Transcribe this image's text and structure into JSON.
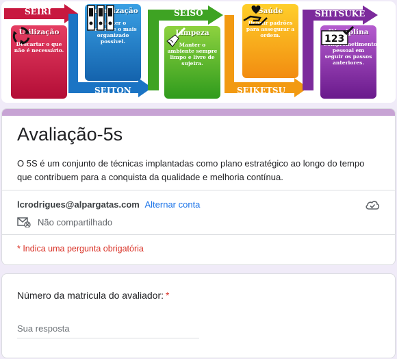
{
  "banner": {
    "steps": [
      {
        "jp": "SEIRI",
        "title": "Utilização",
        "desc": "Descartar o que não é necessário.",
        "icon": "recycle-icon",
        "color": "#c8183f"
      },
      {
        "jp": "SEITON",
        "title": "Organização",
        "desc": "Manter o ambiente o mais organizado possível.",
        "icon": "binders-icon",
        "color": "#1b74c4"
      },
      {
        "jp": "SEISO",
        "title": "Limpeza",
        "desc": "Manter o ambiente sempre limpo e livre de sujeira.",
        "icon": "broom-icon",
        "color": "#3ea323"
      },
      {
        "jp": "SEIKETSU",
        "title": "Saúde",
        "desc": "Definir padrões para assegurar a ordem.",
        "icon": "hand-heart-icon",
        "color": "#f29a12"
      },
      {
        "jp": "SHITSUKE",
        "title": "Disciplina",
        "desc": "Comprometimento pessoal em seguir os passos anteriores.",
        "icon": "checklist-123-icon",
        "color": "#7c2a9c"
      }
    ],
    "disc_digits": "123"
  },
  "form": {
    "title": "Avaliação-5s",
    "description": "O 5S é um conjunto de técnicas implantadas como plano estratégico ao longo do tempo que contribuem para a conquista da qualidade e melhoria contínua.",
    "account_email": "lcrodrigues@alpargatas.com",
    "switch_account": "Alternar conta",
    "not_shared": "Não compartilhado",
    "required_note": "* Indica uma pergunta obrigatória",
    "accent": "#c7a3d4",
    "background": "#f0ebf8"
  },
  "question": {
    "label": "Número da matricula do avaliador:",
    "required_mark": "*",
    "placeholder": "Sua resposta"
  }
}
